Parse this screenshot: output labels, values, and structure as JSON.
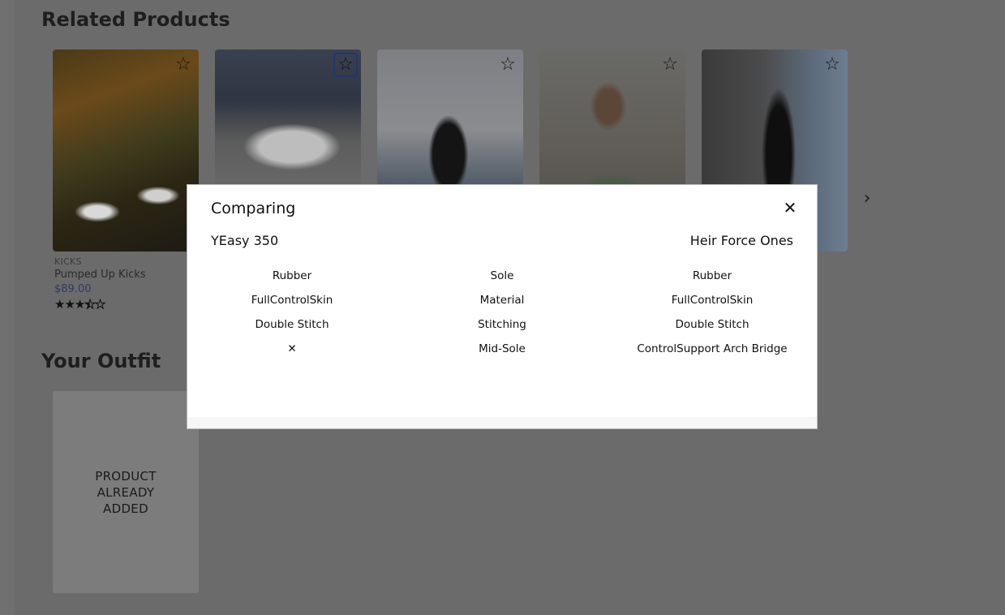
{
  "related": {
    "title": "Related Products",
    "cards": [
      {
        "category": "KICKS",
        "name": "Pumped Up Kicks",
        "price": "$89.00",
        "rating": 3.5,
        "rating_max": 5
      }
    ],
    "next_icon": "chevron-right-icon"
  },
  "outfit": {
    "title": "Your Outfit",
    "added_text": "PRODUCT ALREADY ADDED"
  },
  "modal": {
    "title": "Comparing",
    "close_label": "✕",
    "left_product": "YEasy 350",
    "right_product": "Heir Force Ones",
    "rows": [
      {
        "left": "Rubber",
        "feature": "Sole",
        "right": "Rubber"
      },
      {
        "left": "FullControlSkin",
        "feature": "Material",
        "right": "FullControlSkin"
      },
      {
        "left": "Double Stitch",
        "feature": "Stitching",
        "right": "Double Stitch"
      },
      {
        "left": "✕",
        "feature": "Mid-Sole",
        "right": "ControlSupport Arch Bridge"
      }
    ]
  },
  "colors": {
    "overlay": "#6b6b6b",
    "price": "#2d3a66",
    "focus_border": "#22386b"
  }
}
